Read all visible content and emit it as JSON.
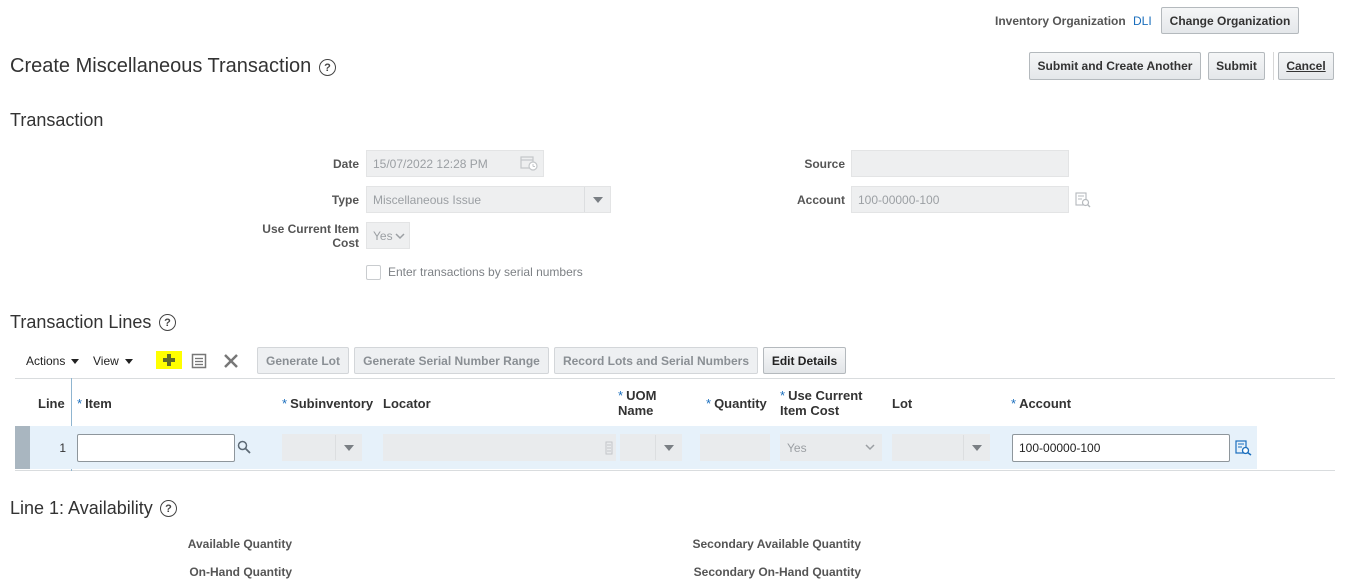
{
  "header": {
    "org_label": "Inventory Organization",
    "org_value": "DLI",
    "change_org_button": "Change Organization"
  },
  "page": {
    "title": "Create Miscellaneous Transaction",
    "help": "?",
    "submit_create_another": "Submit and Create Another",
    "submit": "Submit",
    "cancel": "Cancel"
  },
  "transaction": {
    "section_title": "Transaction",
    "date_label": "Date",
    "date_value": "15/07/2022 12:28 PM",
    "type_label": "Type",
    "type_value": "Miscellaneous Issue",
    "use_current_cost_label_1": "Use Current Item",
    "use_current_cost_label_2": "Cost",
    "use_current_cost_value": "Yes",
    "serial_checkbox_label": "Enter transactions by serial numbers",
    "source_label": "Source",
    "source_value": "",
    "account_label": "Account",
    "account_value": "100-00000-100"
  },
  "lines": {
    "section_title": "Transaction Lines",
    "toolbar": {
      "actions": "Actions",
      "view": "View",
      "generate_lot": "Generate Lot",
      "generate_serial_range": "Generate Serial Number Range",
      "record_lots_serials": "Record Lots and Serial Numbers",
      "edit_details": "Edit Details"
    },
    "columns": {
      "line": "Line",
      "item": "Item",
      "subinventory": "Subinventory",
      "locator": "Locator",
      "uom_1": "UOM",
      "uom_2": "Name",
      "quantity": "Quantity",
      "use_cost_1": "Use Current",
      "use_cost_2": "Item Cost",
      "lot": "Lot",
      "account": "Account"
    },
    "required_marker": "*",
    "rows": [
      {
        "line": "1",
        "item": "",
        "use_cost": "Yes",
        "account": "100-00000-100"
      }
    ]
  },
  "availability": {
    "section_title": "Line 1: Availability",
    "available_qty": "Available Quantity",
    "onhand_qty": "On-Hand Quantity",
    "secondary_available_qty": "Secondary Available Quantity",
    "secondary_onhand_qty": "Secondary On-Hand Quantity"
  },
  "icons": [
    "help-icon",
    "calendar-icon",
    "search-icon",
    "add-icon",
    "detach-icon",
    "delete-icon",
    "chevron-down-icon"
  ],
  "colors": {
    "link": "#1a6ebd",
    "add_highlight": "#ffff00",
    "selected_row": "#e6f1fa",
    "row_marker": "#a9b6c0"
  }
}
